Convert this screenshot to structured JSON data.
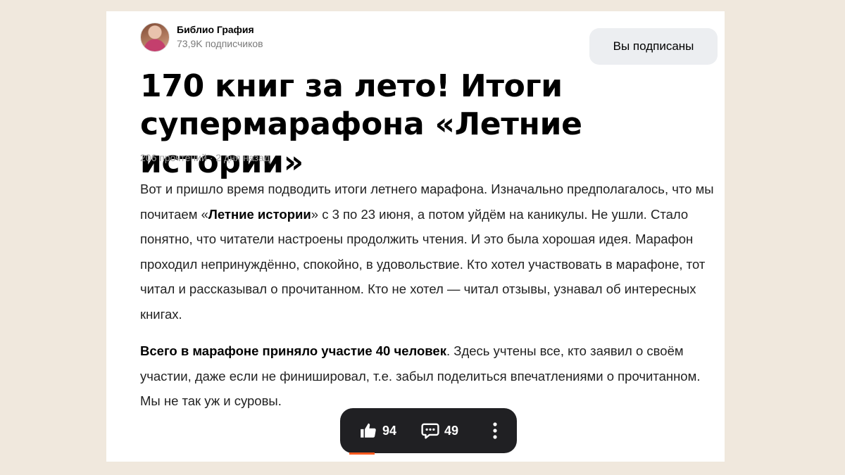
{
  "channel": {
    "name": "Библио Графия",
    "subscribers": "73,9K подписчиков",
    "subscribe_button": "Вы подписаны"
  },
  "article": {
    "title": "170 книг за лето! Итоги супермарафона «Летние истории»",
    "meta": "206 прочтений · 2 дня назад",
    "p1_part1": "Вот и пришло время подводить итоги летнего марафона. Изначально предполагалось, что мы почитаем «",
    "p1_bold": "Летние истории",
    "p1_part2": "» с 3 по 23 июня, а потом уйдём на каникулы. Не ушли. Стало понятно, что читатели настроены продолжить чтения. И это была хорошая идея. Марафон проходил непринуждённо, спокойно, в удовольствие. Кто хотел участвовать в марафоне, тот читал и рассказывал о прочитанном. Кто не хотел — читал отзывы, узнавал об интересных книгах.",
    "p2_bold": "Всего в марафоне приняло участие 40 человек",
    "p2_rest": ". Здесь учтены все, кто заявил о своём участии, даже если не финишировал, т.е. забыл поделиться впечатлениями о прочитанном. Мы не так уж и суровы."
  },
  "actions": {
    "likes": "94",
    "comments": "49",
    "like_icon": "thumbs-up-icon",
    "comment_icon": "comment-icon",
    "more_icon": "more-vertical-icon"
  },
  "colors": {
    "page_background": "#f0e8dd",
    "card_background": "#ffffff",
    "action_bar": "#202023",
    "progress_accent": "#ff5a1f",
    "button_background": "#eceef1"
  }
}
